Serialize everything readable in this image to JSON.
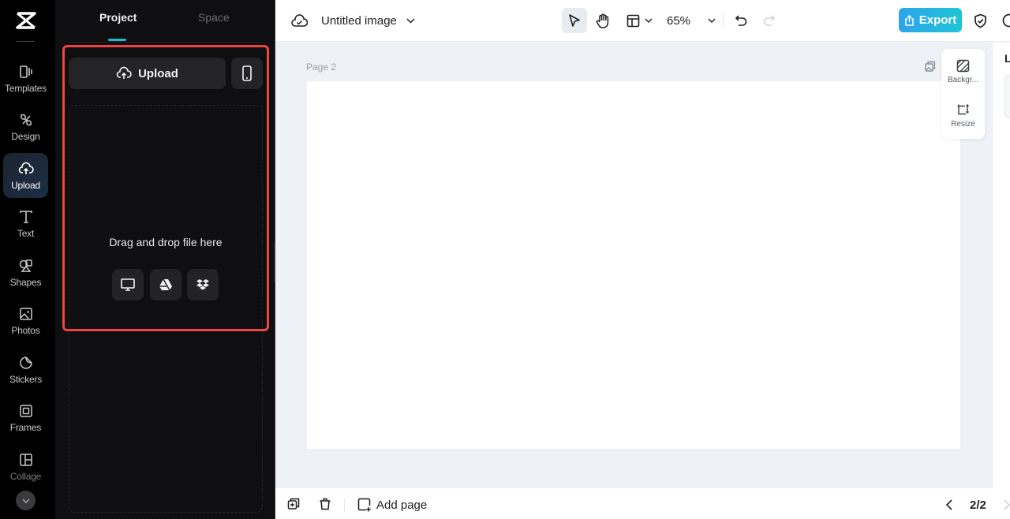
{
  "rail": {
    "items": [
      {
        "label": "Templates",
        "icon": "templates-icon"
      },
      {
        "label": "Design",
        "icon": "design-icon"
      },
      {
        "label": "Upload",
        "icon": "upload-cloud-icon",
        "active": true
      },
      {
        "label": "Text",
        "icon": "text-icon"
      },
      {
        "label": "Shapes",
        "icon": "shapes-icon"
      },
      {
        "label": "Photos",
        "icon": "photos-icon"
      },
      {
        "label": "Stickers",
        "icon": "stickers-icon"
      },
      {
        "label": "Frames",
        "icon": "frames-icon"
      },
      {
        "label": "Collage",
        "icon": "collage-icon"
      }
    ]
  },
  "panel": {
    "tabs": [
      {
        "label": "Project",
        "active": true
      },
      {
        "label": "Space",
        "active": false
      }
    ],
    "upload_label": "Upload",
    "drop_text": "Drag and drop file here",
    "sources": [
      "computer-icon",
      "google-drive-icon",
      "dropbox-icon"
    ]
  },
  "topbar": {
    "title": "Untitled image",
    "zoom": "65%",
    "export_label": "Export"
  },
  "canvas": {
    "page_label": "Page 2"
  },
  "float_panel": {
    "items": [
      {
        "label": "Backgr..."
      },
      {
        "label": "Resize"
      }
    ]
  },
  "right_panel": {
    "heading_initial": "L"
  },
  "bottombar": {
    "add_page_label": "Add page",
    "pager": "2/2"
  },
  "colors": {
    "accent": "#1fbcd3",
    "export_gradient_start": "#2da4ec",
    "export_gradient_end": "#1fc4d6",
    "highlight": "#ef4444"
  }
}
